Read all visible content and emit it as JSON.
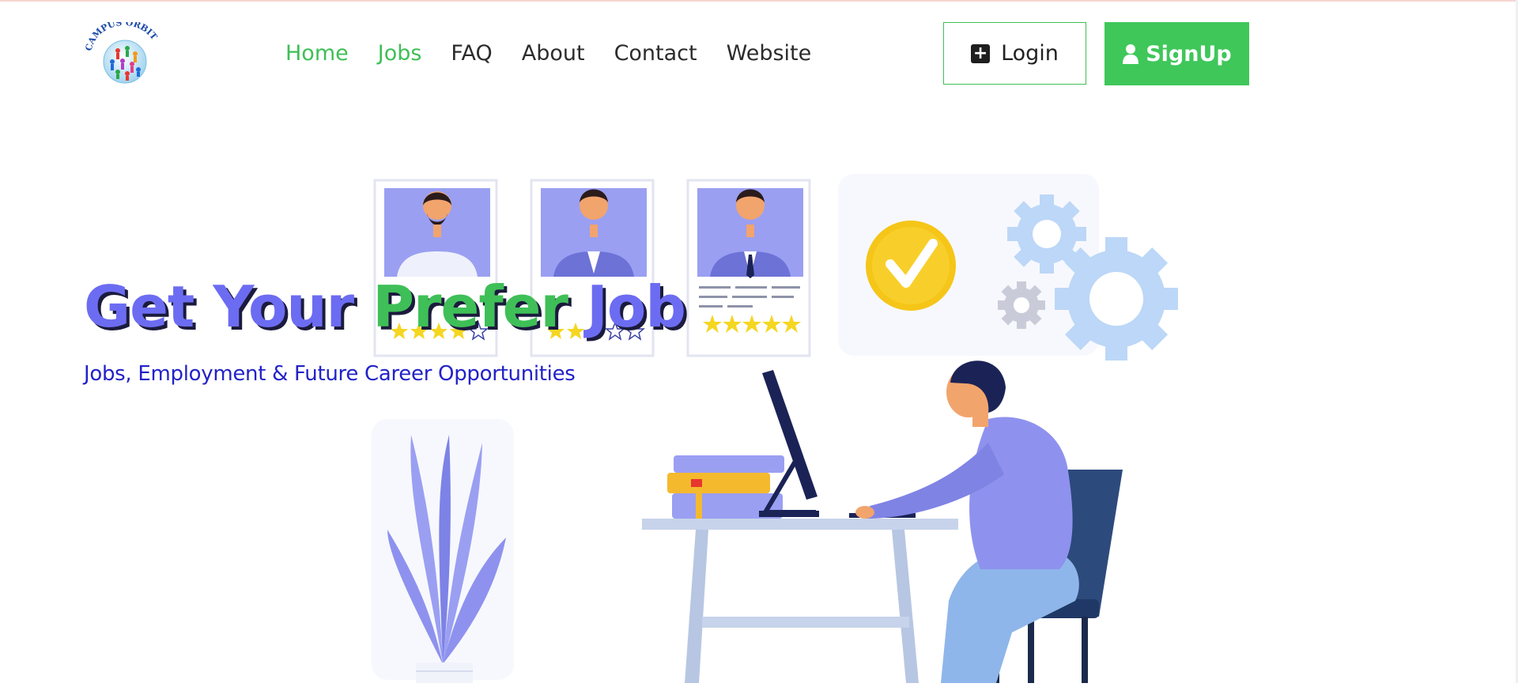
{
  "brand": {
    "logo_text": "CAMPUS ORBIT"
  },
  "nav": {
    "items": [
      {
        "label": "Home",
        "active": true
      },
      {
        "label": "Jobs",
        "active": true
      },
      {
        "label": "FAQ",
        "active": false
      },
      {
        "label": "About",
        "active": false
      },
      {
        "label": "Contact",
        "active": false
      },
      {
        "label": "Website",
        "active": false
      }
    ],
    "login_label": "Login",
    "signup_label": "SignUp",
    "login_icon": "plus-square-icon",
    "signup_icon": "user-icon"
  },
  "hero": {
    "title_part1": "Get Your ",
    "title_part2": "Prefer ",
    "title_part3": "Job",
    "subtitle": "Jobs, Employment & Future Career Opportunities"
  },
  "colors": {
    "accent_green": "#3fc75a",
    "accent_purple": "#6c6cf2",
    "subtitle_blue": "#2222c8"
  }
}
